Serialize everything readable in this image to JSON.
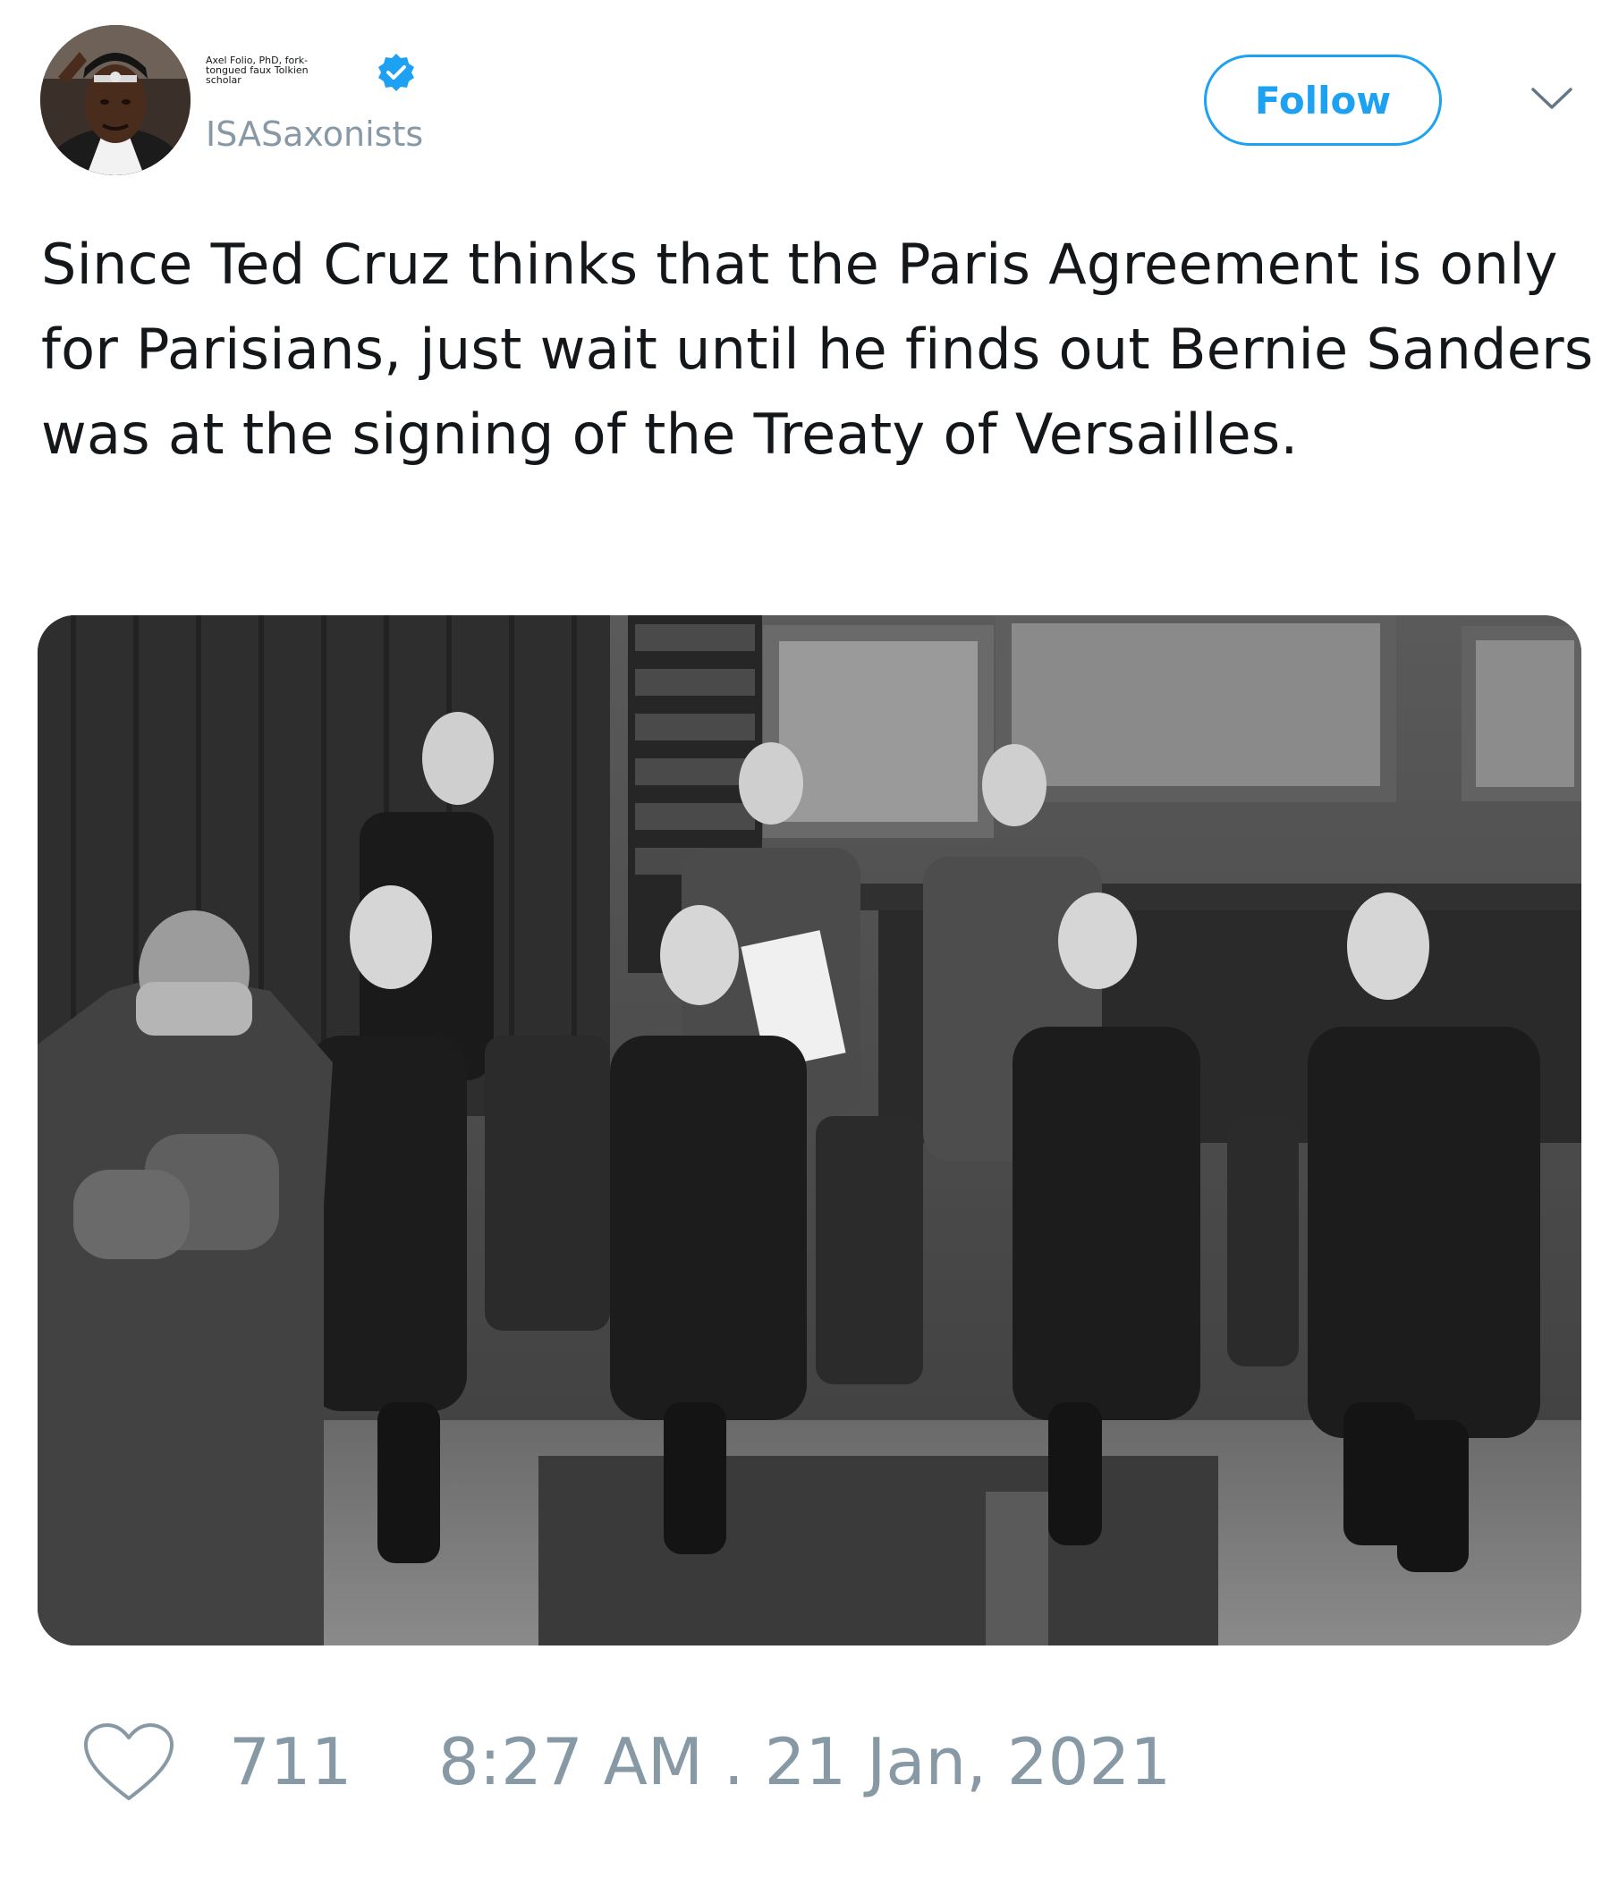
{
  "author": {
    "display_name": "Axel Folio, PhD, fork-tongued faux Tolkien scholar",
    "handle": "ISASaxonists",
    "verified": true,
    "avatar_icon": "profile-photo"
  },
  "follow_button": {
    "label": "Follow",
    "color": "#1da1f2"
  },
  "menu": {
    "icon": "chevron-down-icon"
  },
  "tweet": {
    "text": "Since Ted Cruz thinks that the Paris Agreement is only for Parisians, just wait until he finds out Bernie Sanders was at the signing of the Treaty of Versailles."
  },
  "media": {
    "type": "photo",
    "style": "black-and-white"
  },
  "footer": {
    "like_icon": "heart-icon",
    "like_count": "711",
    "timestamp": "8:27 AM . 21 Jan, 2021"
  },
  "colors": {
    "text": "#14171a",
    "muted": "#8899a6",
    "accent": "#1da1f2"
  }
}
